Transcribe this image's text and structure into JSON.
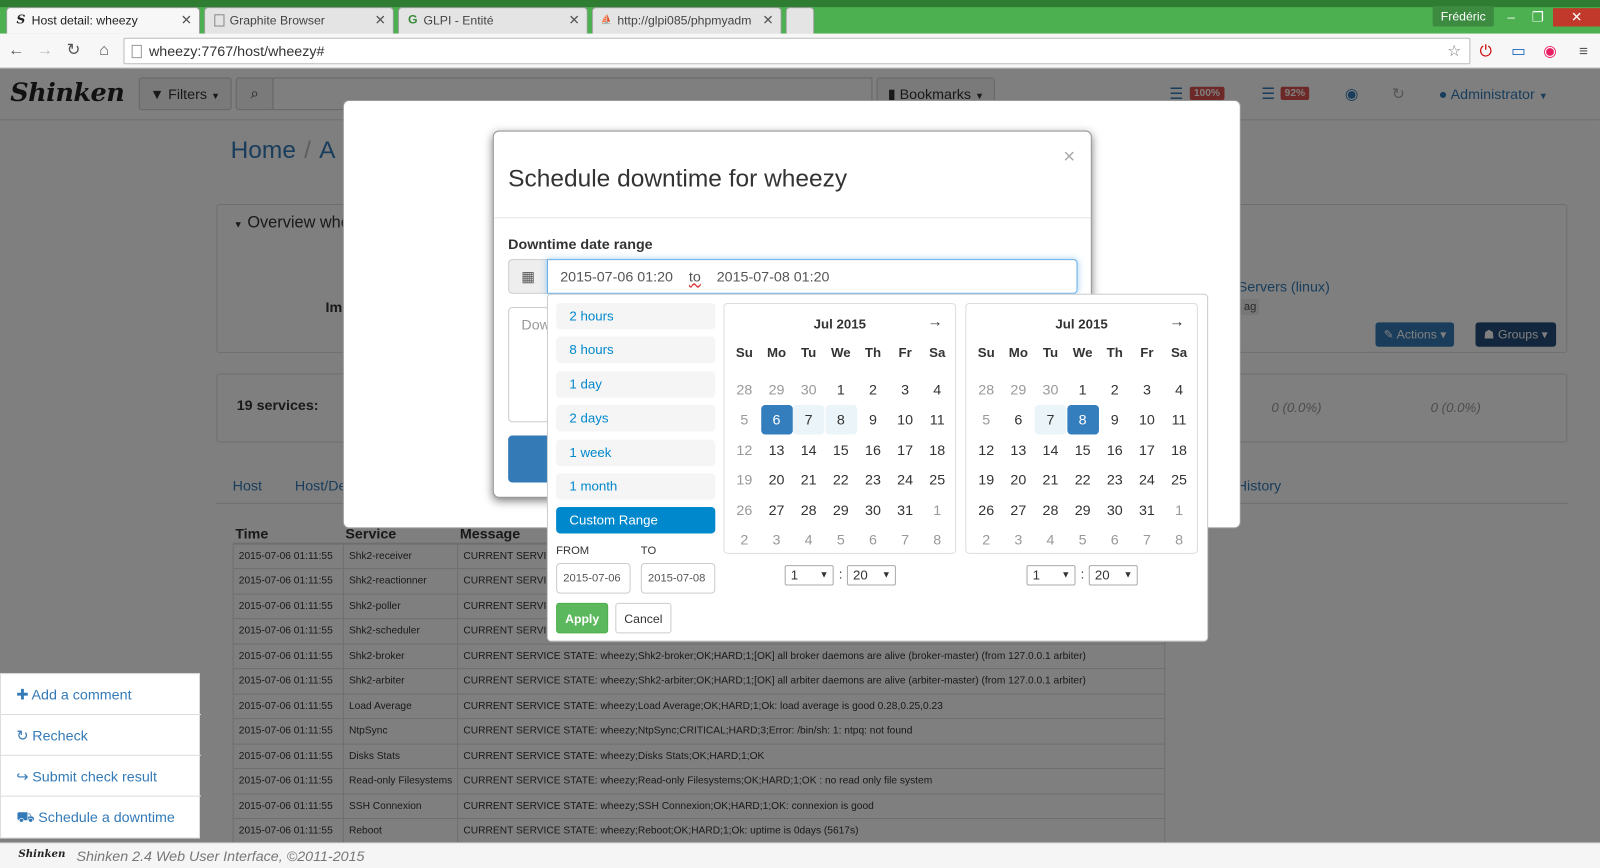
{
  "browser": {
    "tabs": [
      {
        "title": "Host detail: wheezy",
        "icon": "shinken-favicon",
        "active": true
      },
      {
        "title": "Graphite Browser",
        "icon": "page-icon",
        "active": false
      },
      {
        "title": "GLPI - Entité",
        "icon": "glpi-favicon",
        "active": false
      },
      {
        "title": "http://glpi085/phpmyadm",
        "icon": "pma-favicon",
        "active": false
      }
    ],
    "user": "Frédéric",
    "url": "wheezy:7767/host/wheezy#"
  },
  "appnav": {
    "logo": "Shinken",
    "filters_label": "Filters",
    "bookmarks_label": "Bookmarks",
    "badge1": "100%",
    "badge2": "92%",
    "user_label": "Administrator"
  },
  "page": {
    "breadcrumb_home": "Home",
    "breadcrumb_next": "A",
    "overview_label": "Overview whe",
    "imp_label": "Im",
    "services_count": "19 services:",
    "servers_label": "Servers (linux)",
    "tag_label": "ag",
    "stat1": "0 (0.0%)",
    "stat2": "0 (0.0%)",
    "actions_label": "Actions",
    "groups_label": "Groups",
    "tabs": [
      "Host",
      "Host/De",
      "History"
    ],
    "table_headers": [
      "Time",
      "Service",
      "Message"
    ],
    "events": [
      {
        "time": "2015-07-06 01:11:55",
        "service": "Shk2-receiver",
        "message": "CURRENT SERVI"
      },
      {
        "time": "2015-07-06 01:11:55",
        "service": "Shk2-reactionner",
        "message": "CURRENT SERVI"
      },
      {
        "time": "2015-07-06 01:11:55",
        "service": "Shk2-poller",
        "message": "CURRENT SERVI"
      },
      {
        "time": "2015-07-06 01:11:55",
        "service": "Shk2-scheduler",
        "message": "CURRENT SERVI"
      },
      {
        "time": "2015-07-06 01:11:55",
        "service": "Shk2-broker",
        "message": "CURRENT SERVICE STATE: wheezy;Shk2-broker;OK;HARD;1;[OK] all broker daemons are alive (broker-master) (from 127.0.0.1 arbiter)"
      },
      {
        "time": "2015-07-06 01:11:55",
        "service": "Shk2-arbiter",
        "message": "CURRENT SERVICE STATE: wheezy;Shk2-arbiter;OK;HARD;1;[OK] all arbiter daemons are alive (arbiter-master) (from 127.0.0.1 arbiter)"
      },
      {
        "time": "2015-07-06 01:11:55",
        "service": "Load Average",
        "message": "CURRENT SERVICE STATE: wheezy;Load Average;OK;HARD;1;Ok: load average is good 0.28,0.25,0.23"
      },
      {
        "time": "2015-07-06 01:11:55",
        "service": "NtpSync",
        "message": "CURRENT SERVICE STATE: wheezy;NtpSync;CRITICAL;HARD;3;Error: /bin/sh: 1: ntpq: not found"
      },
      {
        "time": "2015-07-06 01:11:55",
        "service": "Disks Stats",
        "message": "CURRENT SERVICE STATE: wheezy;Disks Stats;OK;HARD;1;OK"
      },
      {
        "time": "2015-07-06 01:11:55",
        "service": "Read-only Filesystems",
        "message": "CURRENT SERVICE STATE: wheezy;Read-only Filesystems;OK;HARD;1;OK : no read only file system"
      },
      {
        "time": "2015-07-06 01:11:55",
        "service": "SSH Connexion",
        "message": "CURRENT SERVICE STATE: wheezy;SSH Connexion;OK;HARD;1;OK: connexion is good"
      },
      {
        "time": "2015-07-06 01:11:55",
        "service": "Reboot",
        "message": "CURRENT SERVICE STATE: wheezy;Reboot;OK;HARD;1;Ok: uptime is 0days (5617s)"
      }
    ],
    "side_actions": [
      {
        "label": "Add a comment",
        "icon": "plus-icon"
      },
      {
        "label": "Recheck",
        "icon": "refresh-icon"
      },
      {
        "label": "Submit check result",
        "icon": "share-icon"
      },
      {
        "label": "Schedule a downtime",
        "icon": "ambulance-icon"
      }
    ],
    "footer": "Shinken 2.4 Web User Interface, ©2011-2015",
    "footer_logo": "Shinken"
  },
  "modal": {
    "title": "Schedule downtime for wheezy",
    "close": "×",
    "range_label": "Downtime date range",
    "range_from": "2015-07-06 01:20",
    "range_to": "2015-07-08 01:20",
    "range_sep": "to",
    "comment_placeholder": "Dow"
  },
  "picker": {
    "ranges": [
      "2 hours",
      "8 hours",
      "1 day",
      "2 days",
      "1 week",
      "1 month",
      "Custom Range"
    ],
    "active_range": "Custom Range",
    "from_label": "FROM",
    "to_label": "TO",
    "from_value": "2015-07-06",
    "to_value": "2015-07-08",
    "apply": "Apply",
    "cancel": "Cancel",
    "weekdays": [
      "Su",
      "Mo",
      "Tu",
      "We",
      "Th",
      "Fr",
      "Sa"
    ],
    "calendars": [
      {
        "month": "Jul 2015",
        "days": [
          "28",
          "29",
          "30",
          "1",
          "2",
          "3",
          "4",
          "5",
          "6",
          "7",
          "8",
          "9",
          "10",
          "11",
          "12",
          "13",
          "14",
          "15",
          "16",
          "17",
          "18",
          "19",
          "20",
          "21",
          "22",
          "23",
          "24",
          "25",
          "26",
          "27",
          "28",
          "29",
          "30",
          "31",
          "1",
          "2",
          "3",
          "4",
          "5",
          "6",
          "7",
          "8"
        ],
        "hour": "1",
        "minute": "20"
      },
      {
        "month": "Jul 2015",
        "days": [
          "28",
          "29",
          "30",
          "1",
          "2",
          "3",
          "4",
          "5",
          "6",
          "7",
          "8",
          "9",
          "10",
          "11",
          "12",
          "13",
          "14",
          "15",
          "16",
          "17",
          "18",
          "19",
          "20",
          "21",
          "22",
          "23",
          "24",
          "25",
          "26",
          "27",
          "28",
          "29",
          "30",
          "31",
          "1",
          "2",
          "3",
          "4",
          "5",
          "6",
          "7",
          "8"
        ],
        "hour": "1",
        "minute": "20"
      }
    ],
    "selected_start": "2015-07-06",
    "selected_end": "2015-07-08"
  }
}
